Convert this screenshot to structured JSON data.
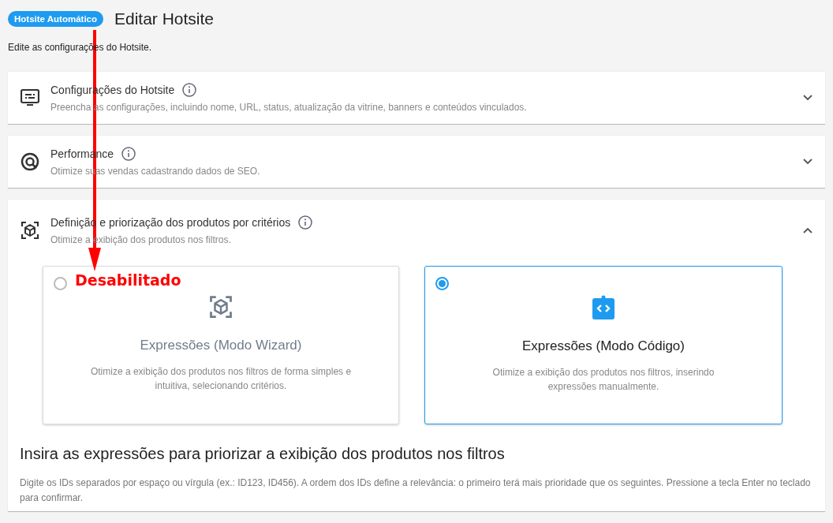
{
  "header": {
    "badge": "Hotsite Automático",
    "title": "Editar Hotsite",
    "subtitle": "Edite as configurações do Hotsite."
  },
  "sections": [
    {
      "kind": "settings",
      "title": "Configurações do Hotsite",
      "description": "Preencha as configurações, incluindo nome, URL, status, atualização da vitrine, banners e conteúdos vinculados.",
      "expanded": false
    },
    {
      "kind": "performance",
      "title": "Performance",
      "description": "Otimize suas vendas cadastrando dados de SEO.",
      "expanded": false
    },
    {
      "kind": "criteria",
      "title": "Definição e priorização dos produtos por critérios",
      "description": "Otimize a exibição dos produtos nos filtros.",
      "expanded": true
    }
  ],
  "modes": [
    {
      "kind": "wizard",
      "title": "Expressões (Modo Wizard)",
      "description": "Otimize a exibição dos produtos nos filtros de forma simples e intuitiva, selecionando critérios.",
      "selected": false,
      "disabled": true
    },
    {
      "kind": "code",
      "title": "Expressões (Modo Código)",
      "description": "Otimize a exibição dos produtos nos filtros, inserindo expressões manualmente.",
      "selected": true,
      "disabled": false
    }
  ],
  "expressions": {
    "heading": "Insira as expressões para priorizar a exibição dos produtos nos filtros",
    "help": "Digite os IDs separados por espaço ou vírgula (ex.: ID123, ID456). A ordem dos IDs define a relevância: o primeiro terá mais prioridade que os seguintes. Pressione a tecla Enter no teclado para confirmar."
  },
  "annotation": {
    "label": "Desabilitado"
  }
}
